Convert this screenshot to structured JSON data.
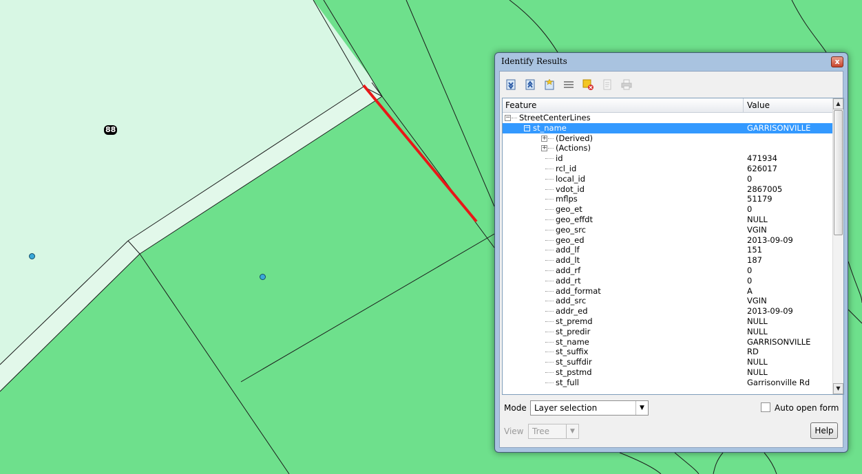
{
  "map": {
    "parcel_label": "88"
  },
  "dialog": {
    "title": "Identify Results",
    "close_label": "x",
    "toolbar": [
      {
        "name": "expand-all-icon"
      },
      {
        "name": "collapse-all-icon"
      },
      {
        "name": "expand-new-icon"
      },
      {
        "name": "open-form-icon"
      },
      {
        "name": "clear-highlights-icon"
      },
      {
        "name": "copy-icon"
      },
      {
        "name": "print-icon"
      }
    ],
    "table": {
      "col_feature": "Feature",
      "col_value": "Value",
      "layer": "StreetCenterLines",
      "feature_name": "st_name",
      "feature_value": "GARRISONVILLE",
      "derived": "(Derived)",
      "actions": "(Actions)",
      "attributes": [
        {
          "name": "id",
          "value": "471934"
        },
        {
          "name": "rcl_id",
          "value": "626017"
        },
        {
          "name": "local_id",
          "value": "0"
        },
        {
          "name": "vdot_id",
          "value": "2867005"
        },
        {
          "name": "mflps",
          "value": "51179"
        },
        {
          "name": "geo_et",
          "value": "0"
        },
        {
          "name": "geo_effdt",
          "value": "NULL"
        },
        {
          "name": "geo_src",
          "value": "VGIN"
        },
        {
          "name": "geo_ed",
          "value": "2013-09-09"
        },
        {
          "name": "add_lf",
          "value": "151"
        },
        {
          "name": "add_lt",
          "value": "187"
        },
        {
          "name": "add_rf",
          "value": "0"
        },
        {
          "name": "add_rt",
          "value": "0"
        },
        {
          "name": "add_format",
          "value": "A"
        },
        {
          "name": "add_src",
          "value": "VGIN"
        },
        {
          "name": "addr_ed",
          "value": "2013-09-09"
        },
        {
          "name": "st_premd",
          "value": "NULL"
        },
        {
          "name": "st_predir",
          "value": "NULL"
        },
        {
          "name": "st_name",
          "value": "GARRISONVILLE"
        },
        {
          "name": "st_suffix",
          "value": "RD"
        },
        {
          "name": "st_suffdir",
          "value": "NULL"
        },
        {
          "name": "st_pstmd",
          "value": "NULL"
        },
        {
          "name": "st_full",
          "value": "Garrisonville Rd"
        }
      ]
    },
    "mode_label": "Mode",
    "mode_value": "Layer selection",
    "auto_open_label": "Auto open form",
    "view_label": "View",
    "view_value": "Tree",
    "help_label": "Help"
  }
}
